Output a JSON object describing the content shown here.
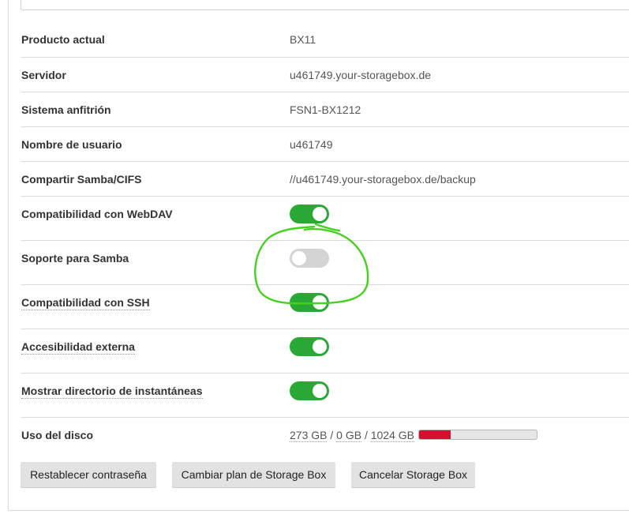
{
  "rows": [
    {
      "label": "Producto actual",
      "value": "BX11"
    },
    {
      "label": "Servidor",
      "value": "u461749.your-storagebox.de"
    },
    {
      "label": "Sistema anfitrión",
      "value": "FSN1-BX1212"
    },
    {
      "label": "Nombre de usuario",
      "value": "u461749"
    },
    {
      "label": "Compartir Samba/CIFS",
      "value": "//u461749.your-storagebox.de/backup"
    }
  ],
  "toggles": [
    {
      "label": "Compatibilidad con WebDAV",
      "on": true
    },
    {
      "label": "Soporte para Samba",
      "on": false
    },
    {
      "label": "Compatibilidad con SSH",
      "on": true
    },
    {
      "label": "Accesibilidad externa",
      "on": true
    },
    {
      "label": "Mostrar directorio de instantáneas",
      "on": true
    }
  ],
  "disk": {
    "label": "Uso del disco",
    "used": "273 GB",
    "snapshots": "0 GB",
    "total": "1024 GB",
    "sep": " / ",
    "fill_fraction": 0.267
  },
  "buttons": {
    "reset_password": "Restablecer contraseña",
    "change_plan": "Cambiar plan de Storage Box",
    "cancel": "Cancelar Storage Box"
  },
  "colors": {
    "toggle_on": "#2aa836",
    "toggle_off": "#d4d4d4",
    "disk_fill": "#d5102f",
    "annotation": "#46d11e"
  }
}
